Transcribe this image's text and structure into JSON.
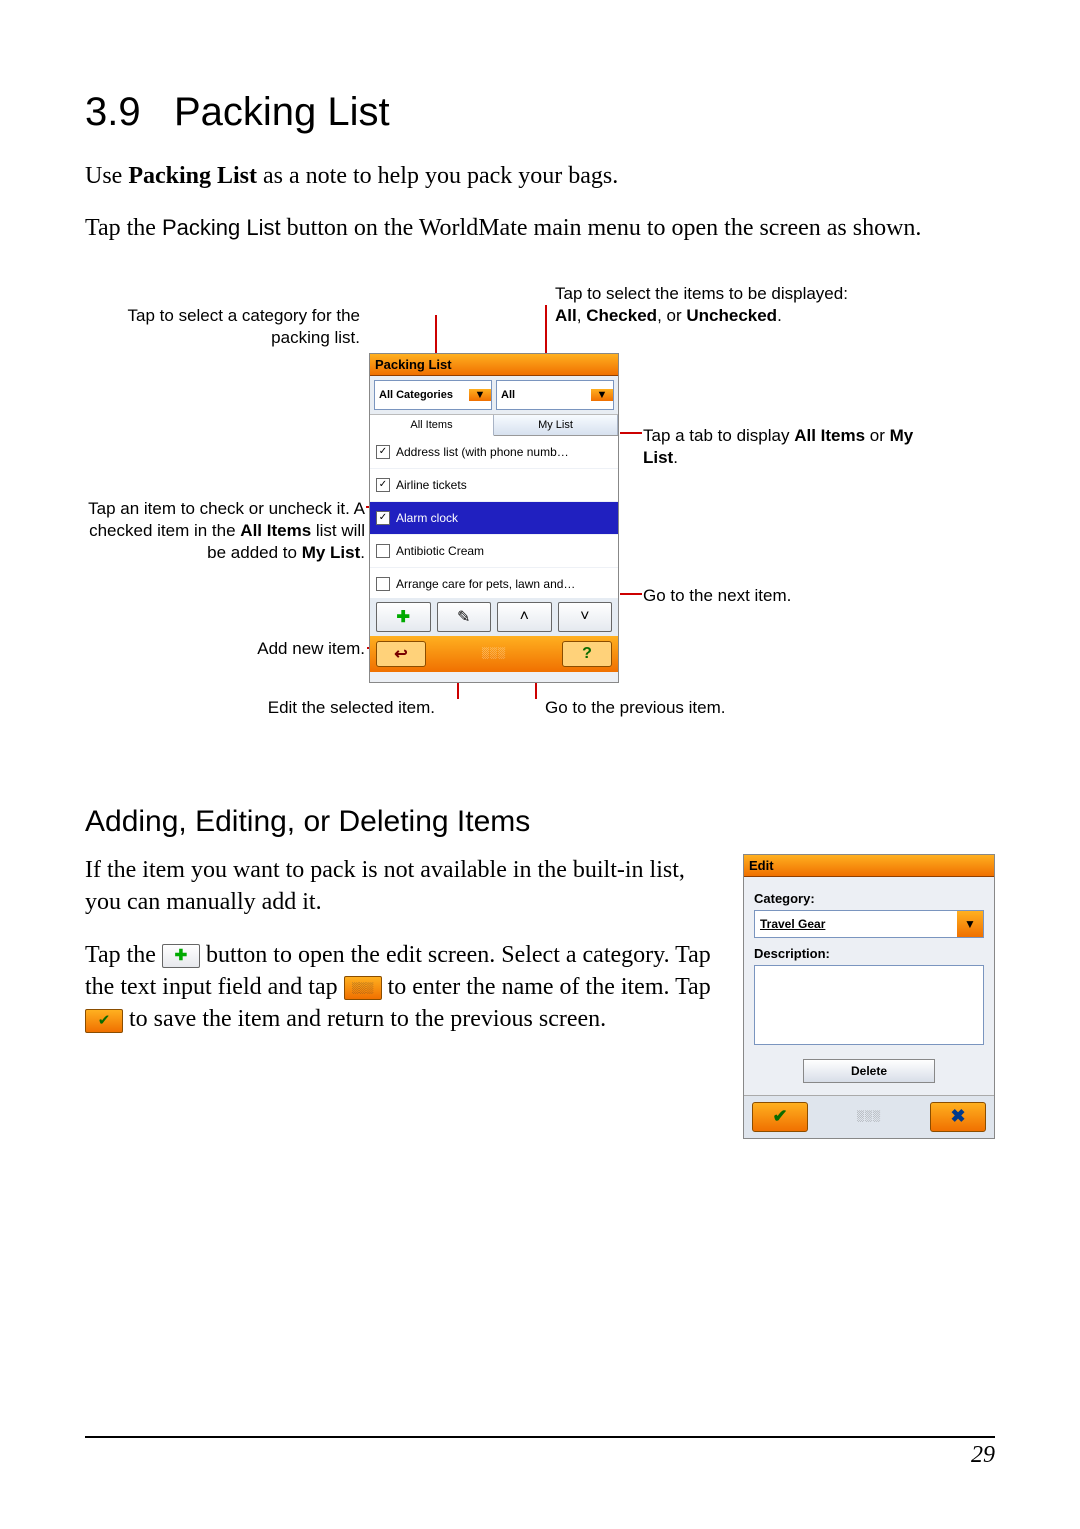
{
  "section_number": "3.9",
  "section_title": "Packing List",
  "para1_a": "Use ",
  "para1_b_bold": "Packing List",
  "para1_c": " as a note to help you pack your bags.",
  "para2_a": "Tap the ",
  "para2_b_sans": "Packing List",
  "para2_c": " button on the WorldMate main menu to open the screen as shown.",
  "callouts": {
    "cat": "Tap to select a category for the packing list.",
    "filter_a": "Tap to select the items to be displayed: ",
    "filter_b1": "All",
    "filter_b2": "Checked",
    "filter_b3": "Unchecked",
    "tabs_a": "Tap a tab to display ",
    "tabs_b1": "All Items",
    "tabs_or": " or ",
    "tabs_b2": "My List",
    "check_a": "Tap an item to check or uncheck it. A checked item in the ",
    "check_b1": "All Items",
    "check_mid": " list will be added to ",
    "check_b2": "My List",
    "next": "Go to the next item.",
    "add": "Add new item.",
    "edit": "Edit the selected item.",
    "prev": "Go to the previous item."
  },
  "screenshot1": {
    "title": "Packing List",
    "dd1": "All Categories",
    "dd2": "All",
    "tab1": "All Items",
    "tab2": "My List",
    "items": [
      {
        "label": "Address list (with phone numb…",
        "checked": true,
        "selected": false
      },
      {
        "label": "Airline tickets",
        "checked": true,
        "selected": false
      },
      {
        "label": "Alarm clock",
        "checked": true,
        "selected": true
      },
      {
        "label": "Antibiotic Cream",
        "checked": false,
        "selected": false
      },
      {
        "label": "Arrange care for pets, lawn and…",
        "checked": false,
        "selected": false
      }
    ]
  },
  "subheading": "Adding, Editing, or Deleting Items",
  "para3": "If the item you want to pack is not available in the built-in list, you can manually add it.",
  "para4_a": "Tap the ",
  "para4_b": " button to open the edit screen. Select a category. Tap the text input field and tap ",
  "para4_c": " to enter the name of the item. Tap ",
  "para4_d": " to save the item and return to the previous screen.",
  "screenshot2": {
    "title": "Edit",
    "label_cat": "Category:",
    "dd_value": "Travel Gear",
    "label_desc": "Description:",
    "delete": "Delete"
  },
  "page_number": "29"
}
